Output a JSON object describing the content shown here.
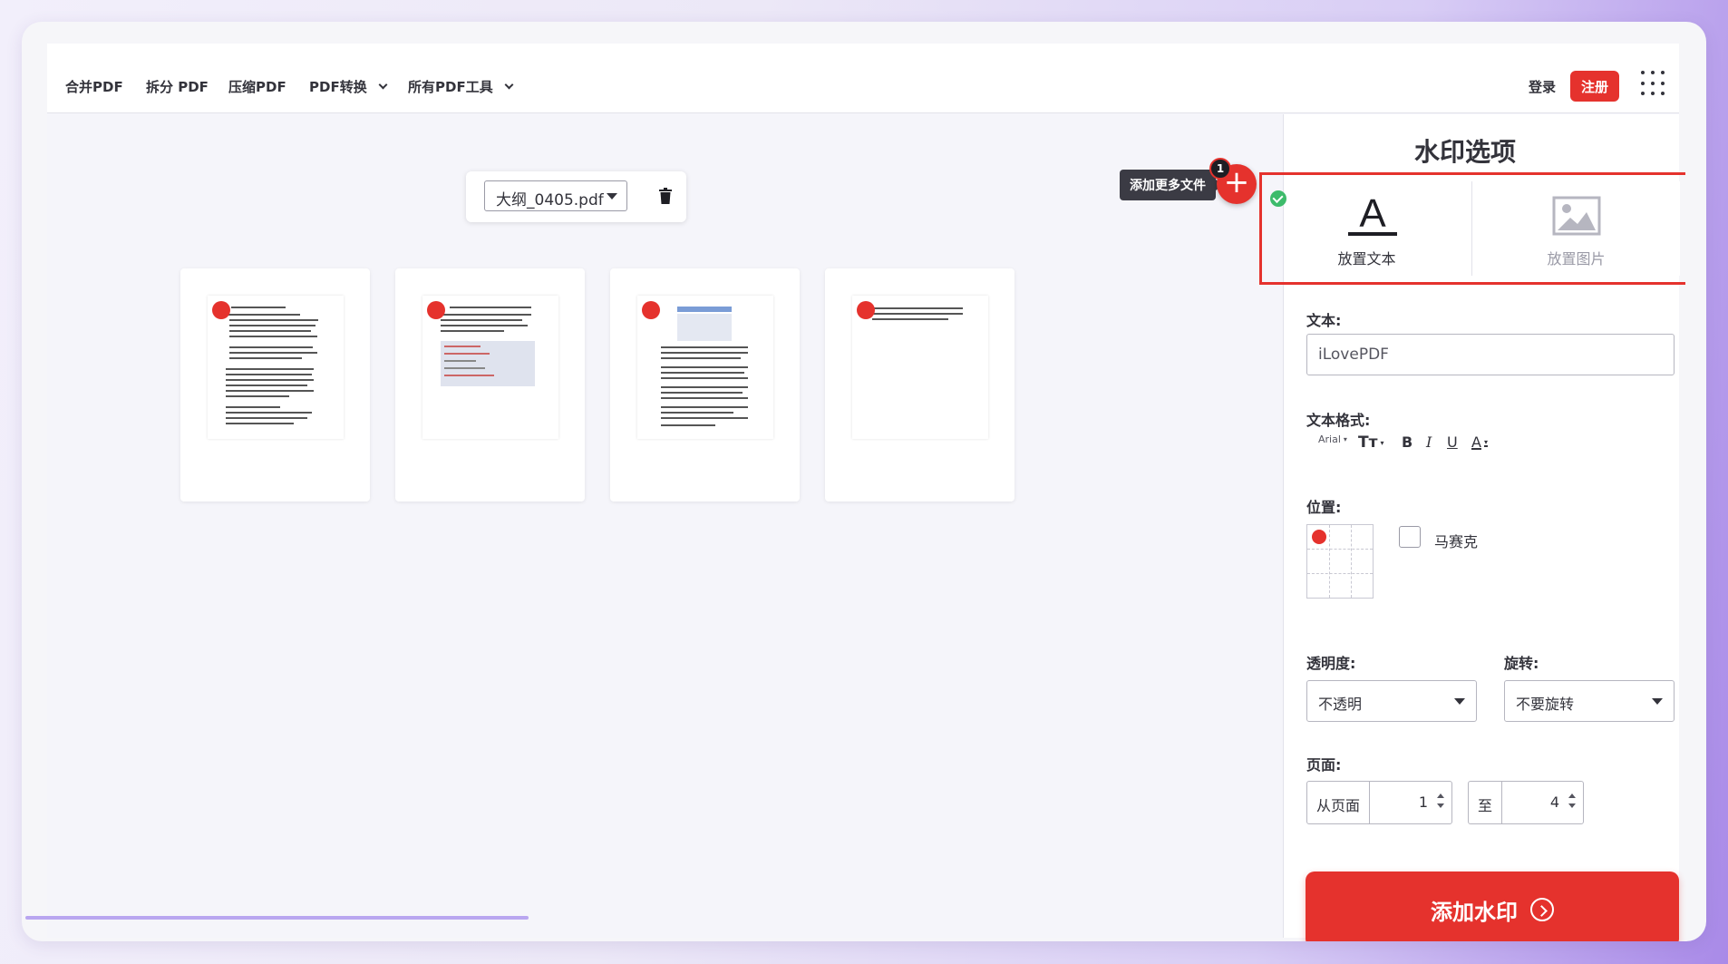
{
  "nav": {
    "items": [
      {
        "label": "合并PDF"
      },
      {
        "label": "拆分 PDF"
      },
      {
        "label": "压缩PDF"
      },
      {
        "label": "PDF转换"
      },
      {
        "label": "所有PDF工具"
      }
    ],
    "login": "登录",
    "signup": "注册"
  },
  "workspace": {
    "file_name": "大纲_0405.pdf",
    "add_more_tooltip": "添加更多文件",
    "add_badge": "1"
  },
  "panel": {
    "title": "水印选项",
    "mode_text": "放置文本",
    "mode_image": "放置图片",
    "text_label": "文本:",
    "text_value": "iLovePDF",
    "format_label": "文本格式:",
    "font": "Arial",
    "format_icons": [
      "font-size-icon",
      "bold-icon",
      "italic-icon",
      "underline-icon",
      "font-color-icon"
    ],
    "position_label": "位置:",
    "mosaic_label": "马赛克",
    "opacity_label": "透明度:",
    "opacity_value": "不透明",
    "rotation_label": "旋转:",
    "rotation_value": "不要旋转",
    "pages_label": "页面:",
    "from_label": "从页面",
    "from_value": "1",
    "to_label": "至",
    "to_value": "4",
    "submit": "添加水印"
  },
  "colors": {
    "accent": "#e5322d",
    "check": "#3dbb6b"
  }
}
